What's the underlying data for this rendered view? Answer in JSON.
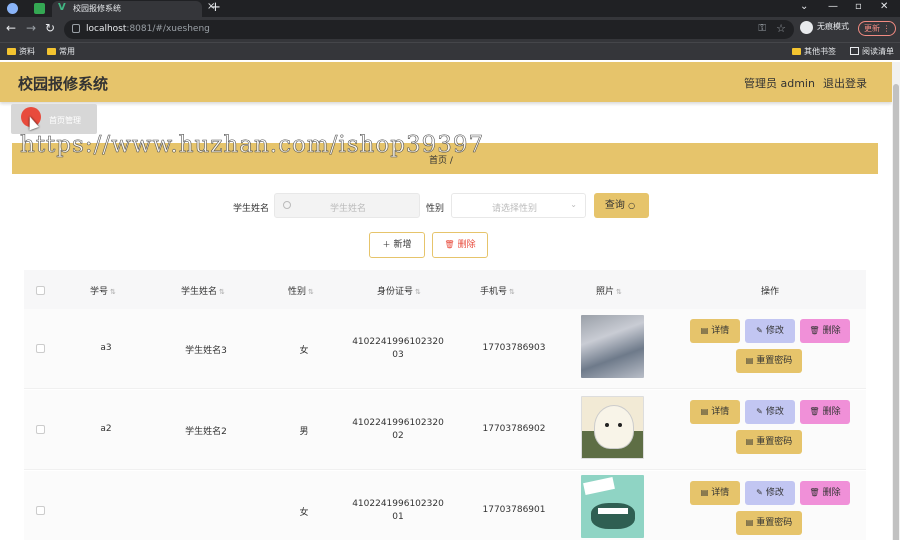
{
  "browser": {
    "tab_title": "校园报修系统",
    "url_host": "localhost",
    "url_rest": ":8081/#/xuesheng",
    "incognito_label": "无痕模式",
    "update_label": "更新",
    "bookmarks": [
      "资料",
      "常用",
      "其他书签",
      "阅读清单"
    ]
  },
  "header": {
    "title": "校园报修系统",
    "admin": "管理员 admin",
    "logout": "退出登录"
  },
  "tagview": {
    "label": "首页管理"
  },
  "breadcrumb": {
    "home": "首页",
    "separator": "/",
    "current": ""
  },
  "watermark": "https://www.huzhan.com/ishop39397",
  "search": {
    "name_label": "学生姓名",
    "name_placeholder": "学生姓名",
    "gender_label": "性别",
    "gender_placeholder": "请选择性别",
    "query_button": "查询"
  },
  "actions": {
    "add": "新增",
    "delete": "删除"
  },
  "table": {
    "headers": [
      "学号",
      "学生姓名",
      "性别",
      "身份证号",
      "手机号",
      "照片",
      "操作"
    ],
    "rows": [
      {
        "id": "a3",
        "name": "学生姓名3",
        "gender": "女",
        "idcard_1": "4102241996102320",
        "idcard_2": "03",
        "phone": "17703786903"
      },
      {
        "id": "a2",
        "name": "学生姓名2",
        "gender": "男",
        "idcard_1": "4102241996102320",
        "idcard_2": "02",
        "phone": "17703786902"
      },
      {
        "id": "",
        "name": "",
        "gender": "女",
        "idcard_1": "4102241996102320",
        "idcard_2": "01",
        "phone": "17703786901"
      }
    ],
    "row_buttons": {
      "detail": "详情",
      "edit": "修改",
      "delete": "删除",
      "reset": "重置密码"
    }
  },
  "colors": {
    "accent": "#e6c46b",
    "edit": "#c2c6f2",
    "delete": "#f090d8",
    "danger_text": "#e84b3c"
  }
}
